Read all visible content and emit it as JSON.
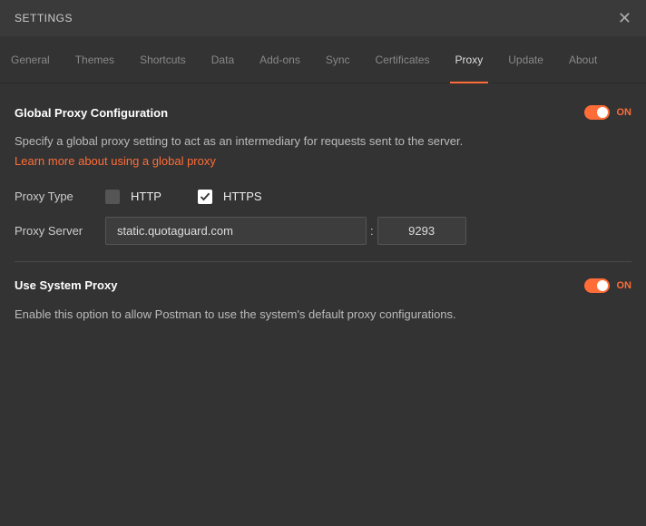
{
  "header": {
    "title": "SETTINGS"
  },
  "tabs": [
    {
      "label": "General"
    },
    {
      "label": "Themes"
    },
    {
      "label": "Shortcuts"
    },
    {
      "label": "Data"
    },
    {
      "label": "Add-ons"
    },
    {
      "label": "Sync"
    },
    {
      "label": "Certificates"
    },
    {
      "label": "Proxy"
    },
    {
      "label": "Update"
    },
    {
      "label": "About"
    }
  ],
  "globalProxy": {
    "title": "Global Proxy Configuration",
    "toggle": "ON",
    "description": "Specify a global proxy setting to act as an intermediary for requests sent to the server.",
    "link": "Learn more about using a global proxy",
    "proxyTypeLabel": "Proxy Type",
    "httpLabel": "HTTP",
    "httpsLabel": "HTTPS",
    "proxyServerLabel": "Proxy Server",
    "host": "static.quotaguard.com",
    "port": "9293"
  },
  "systemProxy": {
    "title": "Use System Proxy",
    "toggle": "ON",
    "description": "Enable this option to allow Postman to use the system's default proxy configurations."
  }
}
